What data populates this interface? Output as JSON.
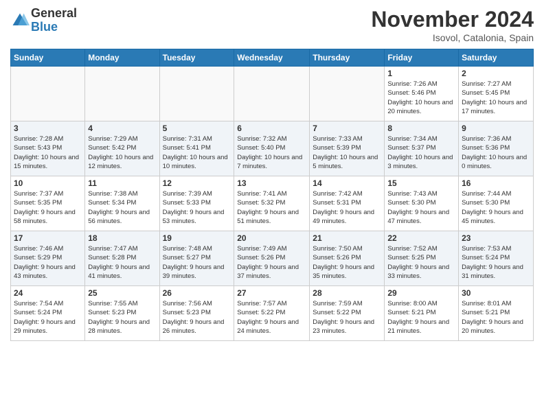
{
  "header": {
    "logo_general": "General",
    "logo_blue": "Blue",
    "month_title": "November 2024",
    "location": "Isovol, Catalonia, Spain"
  },
  "weekdays": [
    "Sunday",
    "Monday",
    "Tuesday",
    "Wednesday",
    "Thursday",
    "Friday",
    "Saturday"
  ],
  "weeks": [
    [
      {
        "day": "",
        "info": ""
      },
      {
        "day": "",
        "info": ""
      },
      {
        "day": "",
        "info": ""
      },
      {
        "day": "",
        "info": ""
      },
      {
        "day": "",
        "info": ""
      },
      {
        "day": "1",
        "info": "Sunrise: 7:26 AM\nSunset: 5:46 PM\nDaylight: 10 hours and 20 minutes."
      },
      {
        "day": "2",
        "info": "Sunrise: 7:27 AM\nSunset: 5:45 PM\nDaylight: 10 hours and 17 minutes."
      }
    ],
    [
      {
        "day": "3",
        "info": "Sunrise: 7:28 AM\nSunset: 5:43 PM\nDaylight: 10 hours and 15 minutes."
      },
      {
        "day": "4",
        "info": "Sunrise: 7:29 AM\nSunset: 5:42 PM\nDaylight: 10 hours and 12 minutes."
      },
      {
        "day": "5",
        "info": "Sunrise: 7:31 AM\nSunset: 5:41 PM\nDaylight: 10 hours and 10 minutes."
      },
      {
        "day": "6",
        "info": "Sunrise: 7:32 AM\nSunset: 5:40 PM\nDaylight: 10 hours and 7 minutes."
      },
      {
        "day": "7",
        "info": "Sunrise: 7:33 AM\nSunset: 5:39 PM\nDaylight: 10 hours and 5 minutes."
      },
      {
        "day": "8",
        "info": "Sunrise: 7:34 AM\nSunset: 5:37 PM\nDaylight: 10 hours and 3 minutes."
      },
      {
        "day": "9",
        "info": "Sunrise: 7:36 AM\nSunset: 5:36 PM\nDaylight: 10 hours and 0 minutes."
      }
    ],
    [
      {
        "day": "10",
        "info": "Sunrise: 7:37 AM\nSunset: 5:35 PM\nDaylight: 9 hours and 58 minutes."
      },
      {
        "day": "11",
        "info": "Sunrise: 7:38 AM\nSunset: 5:34 PM\nDaylight: 9 hours and 56 minutes."
      },
      {
        "day": "12",
        "info": "Sunrise: 7:39 AM\nSunset: 5:33 PM\nDaylight: 9 hours and 53 minutes."
      },
      {
        "day": "13",
        "info": "Sunrise: 7:41 AM\nSunset: 5:32 PM\nDaylight: 9 hours and 51 minutes."
      },
      {
        "day": "14",
        "info": "Sunrise: 7:42 AM\nSunset: 5:31 PM\nDaylight: 9 hours and 49 minutes."
      },
      {
        "day": "15",
        "info": "Sunrise: 7:43 AM\nSunset: 5:30 PM\nDaylight: 9 hours and 47 minutes."
      },
      {
        "day": "16",
        "info": "Sunrise: 7:44 AM\nSunset: 5:30 PM\nDaylight: 9 hours and 45 minutes."
      }
    ],
    [
      {
        "day": "17",
        "info": "Sunrise: 7:46 AM\nSunset: 5:29 PM\nDaylight: 9 hours and 43 minutes."
      },
      {
        "day": "18",
        "info": "Sunrise: 7:47 AM\nSunset: 5:28 PM\nDaylight: 9 hours and 41 minutes."
      },
      {
        "day": "19",
        "info": "Sunrise: 7:48 AM\nSunset: 5:27 PM\nDaylight: 9 hours and 39 minutes."
      },
      {
        "day": "20",
        "info": "Sunrise: 7:49 AM\nSunset: 5:26 PM\nDaylight: 9 hours and 37 minutes."
      },
      {
        "day": "21",
        "info": "Sunrise: 7:50 AM\nSunset: 5:26 PM\nDaylight: 9 hours and 35 minutes."
      },
      {
        "day": "22",
        "info": "Sunrise: 7:52 AM\nSunset: 5:25 PM\nDaylight: 9 hours and 33 minutes."
      },
      {
        "day": "23",
        "info": "Sunrise: 7:53 AM\nSunset: 5:24 PM\nDaylight: 9 hours and 31 minutes."
      }
    ],
    [
      {
        "day": "24",
        "info": "Sunrise: 7:54 AM\nSunset: 5:24 PM\nDaylight: 9 hours and 29 minutes."
      },
      {
        "day": "25",
        "info": "Sunrise: 7:55 AM\nSunset: 5:23 PM\nDaylight: 9 hours and 28 minutes."
      },
      {
        "day": "26",
        "info": "Sunrise: 7:56 AM\nSunset: 5:23 PM\nDaylight: 9 hours and 26 minutes."
      },
      {
        "day": "27",
        "info": "Sunrise: 7:57 AM\nSunset: 5:22 PM\nDaylight: 9 hours and 24 minutes."
      },
      {
        "day": "28",
        "info": "Sunrise: 7:59 AM\nSunset: 5:22 PM\nDaylight: 9 hours and 23 minutes."
      },
      {
        "day": "29",
        "info": "Sunrise: 8:00 AM\nSunset: 5:21 PM\nDaylight: 9 hours and 21 minutes."
      },
      {
        "day": "30",
        "info": "Sunrise: 8:01 AM\nSunset: 5:21 PM\nDaylight: 9 hours and 20 minutes."
      }
    ]
  ]
}
